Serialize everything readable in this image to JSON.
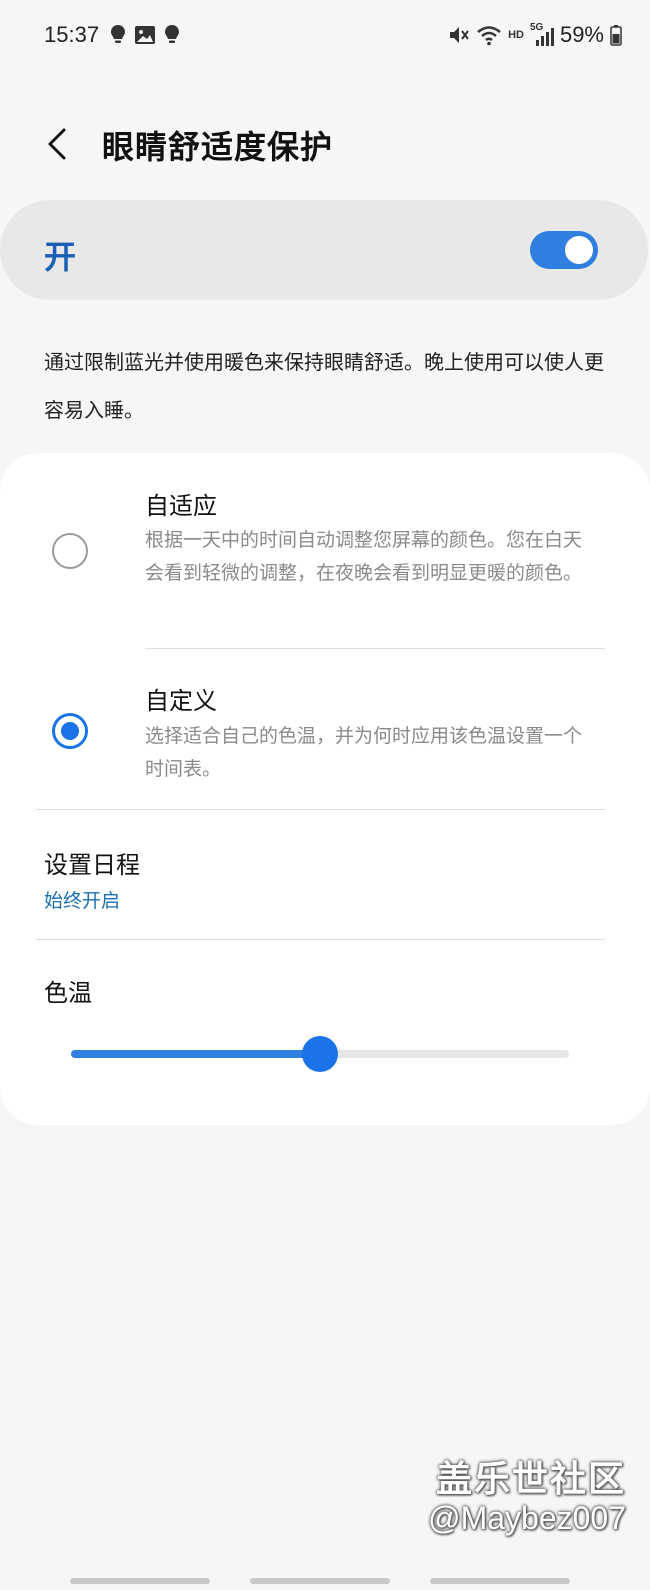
{
  "status_bar": {
    "time": "15:37",
    "left_icons": [
      "bulb-icon",
      "image-icon",
      "bulb-icon"
    ],
    "right_icons": [
      "mute-icon",
      "wifi-icon",
      "hd-icon",
      "signal-5g-icon",
      "battery-icon"
    ],
    "hd_label": "HD",
    "network_label": "5G",
    "battery_percent": "59%"
  },
  "header": {
    "title": "眼睛舒适度保护",
    "back_icon": "chevron-left-icon"
  },
  "master_toggle": {
    "label": "开",
    "on": true,
    "accent": "#2f7ee0"
  },
  "description": "通过限制蓝光并使用暖色来保持眼睛舒适。晚上使用可以使人更容易入睡。",
  "options": [
    {
      "title": "自适应",
      "description": "根据一天中的时间自动调整您屏幕的颜色。您在白天会看到轻微的调整，在夜晚会看到明显更暖的颜色。",
      "selected": false
    },
    {
      "title": "自定义",
      "description": "选择适合自己的色温，并为何时应用该色温设置一个时间表。",
      "selected": true
    }
  ],
  "schedule": {
    "title": "设置日程",
    "value": "始终开启"
  },
  "color_temperature": {
    "title": "色温",
    "level_fraction": 0.5
  },
  "watermark": {
    "line1": "盖乐世社区",
    "line2": "@Maybez007"
  }
}
